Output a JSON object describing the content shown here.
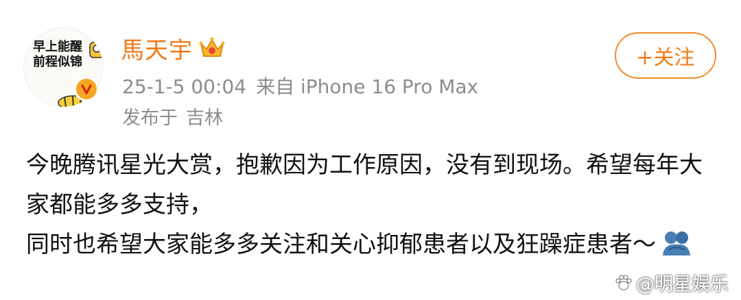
{
  "author": {
    "avatar_text": "早上能醒\n前程似锦",
    "name": "馬天宇"
  },
  "post_meta": {
    "date": "25-1-5 00:04",
    "source": "来自 iPhone 16 Pro Max",
    "location_prefix": "发布于",
    "location": "吉林"
  },
  "follow_button": {
    "label": "+关注"
  },
  "post": {
    "paragraph_1": "今晚腾讯星光大赏，抱歉因为工作原因，没有到现场。希望每年大家都能多多支持，",
    "paragraph_2": "同时也希望大家能多多关注和关心抑郁患者以及狂躁症患者～"
  },
  "watermark": {
    "text": "@明星娱乐"
  },
  "colors": {
    "accent_orange": "#f27a16",
    "meta_gray": "#8c8c8c",
    "badge_orange": "#f5a623"
  },
  "icons": {
    "verified": "verified-badge-icon",
    "crown": "crown-icon",
    "hug_emoji": "hug-emoji-icon",
    "watermark_logo": "paw-icon"
  }
}
